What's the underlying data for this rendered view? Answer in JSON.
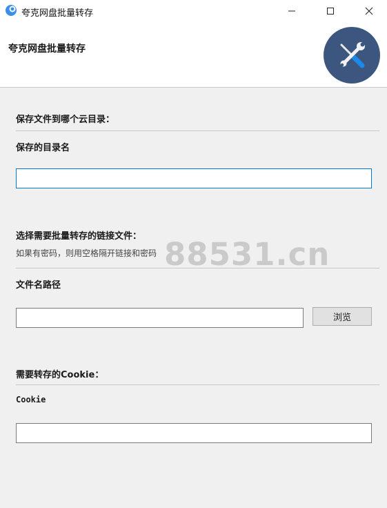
{
  "window": {
    "title": "夸克网盘批量转存"
  },
  "header": {
    "title": "夸克网盘批量转存",
    "logo_icon": "tools-icon (wrench and screwdriver)"
  },
  "save_section": {
    "title": "保存文件到哪个云目录：",
    "dir_label": "保存的目录名",
    "dir_value": ""
  },
  "link_section": {
    "title": "选择需要批量转存的链接文件：",
    "hint": "如果有密码，则用空格隔开链接和密码",
    "path_label": "文件名路径",
    "path_value": "",
    "browse_label": "浏览"
  },
  "cookie_section": {
    "title": "需要转存的Cookie：",
    "cookie_label": "Cookie",
    "cookie_value": ""
  },
  "watermark": "88531.cn",
  "colors": {
    "logo_bg": "#3d5680",
    "focus_border": "#0078d7",
    "icon_blue": "#1e88e5"
  }
}
